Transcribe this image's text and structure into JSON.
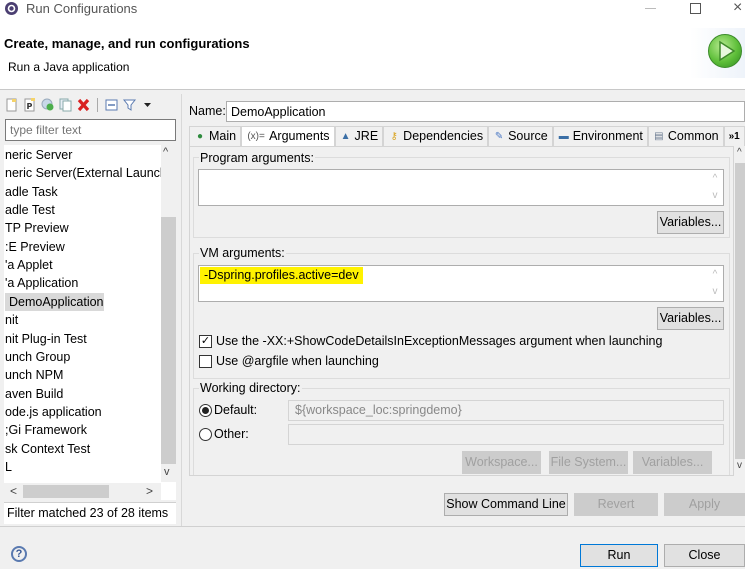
{
  "window": {
    "title": "Run Configurations",
    "controls": {
      "minimize": "minimize",
      "maximize": "maximize",
      "close": "×"
    }
  },
  "banner": {
    "title": "Create, manage, and run configurations",
    "subtitle": "Run a Java application"
  },
  "left_panel": {
    "toolbar": [
      "new-configuration-icon",
      "new-prototype-icon",
      "export-icon",
      "duplicate-icon",
      "delete-icon",
      "collapse-all-icon",
      "filter-icon",
      "view-menu-icon"
    ],
    "filter_placeholder": "type filter text",
    "filter_value": "",
    "tree_items": [
      {
        "label": "neric Server",
        "indent": 0
      },
      {
        "label": "neric Server(External Launch",
        "indent": 0
      },
      {
        "label": "adle Task",
        "indent": 0
      },
      {
        "label": "adle Test",
        "indent": 0
      },
      {
        "label": "TP Preview",
        "indent": 0
      },
      {
        "label": ":E Preview",
        "indent": 0
      },
      {
        "label": "'a Applet",
        "indent": 0
      },
      {
        "label": "'a Application",
        "indent": 0
      },
      {
        "label": "DemoApplication",
        "indent": 1,
        "selected": true
      },
      {
        "label": "nit",
        "indent": 0
      },
      {
        "label": "nit Plug-in Test",
        "indent": 0
      },
      {
        "label": "unch Group",
        "indent": 0
      },
      {
        "label": "unch NPM",
        "indent": 0
      },
      {
        "label": "aven Build",
        "indent": 0
      },
      {
        "label": "ode.js application",
        "indent": 0
      },
      {
        "label": ";Gi Framework",
        "indent": 0
      },
      {
        "label": "sk Context Test",
        "indent": 0
      },
      {
        "label": "L",
        "indent": 0
      }
    ],
    "scroll": {
      "up": "^",
      "down": "v",
      "left": "<",
      "right": ">"
    },
    "filter_status": "Filter matched 23 of 28 items"
  },
  "config": {
    "name_label": "Name:",
    "name_value": "DemoApplication",
    "tabs": [
      {
        "label": "Main",
        "icon": "main-tab-icon",
        "glyph": "●",
        "color": "#2e8b3e"
      },
      {
        "label": "Arguments",
        "icon": "arguments-tab-icon",
        "glyph": "(x)=",
        "color": "#555555",
        "active": true
      },
      {
        "label": "JRE",
        "icon": "jre-tab-icon",
        "glyph": "▲",
        "color": "#3a6ea5"
      },
      {
        "label": "Dependencies",
        "icon": "dependencies-tab-icon",
        "glyph": "⚷",
        "color": "#d9a420"
      },
      {
        "label": "Source",
        "icon": "source-tab-icon",
        "glyph": "✎",
        "color": "#4a78c4"
      },
      {
        "label": "Environment",
        "icon": "environment-tab-icon",
        "glyph": "▬",
        "color": "#3a6ea5"
      },
      {
        "label": "Common",
        "icon": "common-tab-icon",
        "glyph": "▤",
        "color": "#6a7a90"
      }
    ],
    "tabs_overflow": "»1",
    "program_args": {
      "label": "Program arguments:",
      "value": "",
      "variables_button": "Variables..."
    },
    "vm_args": {
      "label": "VM arguments:",
      "value": "-Dspring.profiles.active=dev",
      "variables_button": "Variables...",
      "highlight_color": "#fff200"
    },
    "options": [
      {
        "label": "Use the -XX:+ShowCodeDetailsInExceptionMessages argument when launching",
        "checked": true
      },
      {
        "label": "Use @argfile when launching",
        "checked": false
      }
    ],
    "working_dir": {
      "label": "Working directory:",
      "default_label": "Default:",
      "default_value": "${workspace_loc:springdemo}",
      "default_selected": true,
      "other_label": "Other:",
      "other_value": "",
      "buttons": [
        "Workspace...",
        "File System...",
        "Variables..."
      ]
    },
    "actions": {
      "show_command_line": "Show Command Line",
      "revert": "Revert",
      "apply": "Apply"
    }
  },
  "footer": {
    "help": "?",
    "run": "Run",
    "close": "Close"
  },
  "colors": {
    "accent": "#0078d7",
    "highlight": "#fff200",
    "run_green": "#5fbf3a",
    "delete_red": "#d92020"
  }
}
